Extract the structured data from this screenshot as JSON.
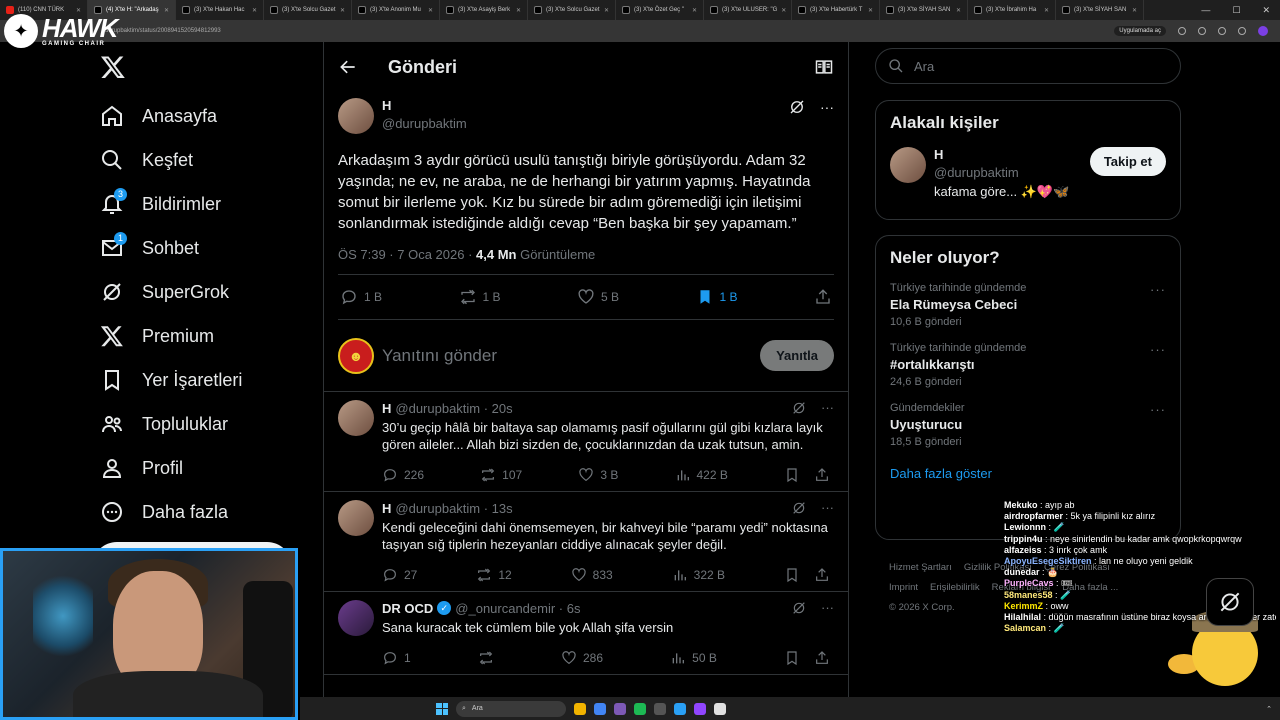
{
  "browser": {
    "tabs": [
      {
        "label": "(110) CNN TÜRK",
        "icon": "youtube-icon",
        "active": false
      },
      {
        "label": "(4) X'te H: \"Arkadaş",
        "icon": "x-icon",
        "active": true
      },
      {
        "label": "(3) X'te Hakan Hac",
        "icon": "x-icon",
        "active": false
      },
      {
        "label": "(3) X'te Solcu Gazet",
        "icon": "x-icon",
        "active": false
      },
      {
        "label": "(3) X'te Anonim Mu",
        "icon": "x-icon",
        "active": false
      },
      {
        "label": "(3) X'te Asayiş Berk",
        "icon": "x-icon",
        "active": false
      },
      {
        "label": "(3) X'te Solcu Gazet",
        "icon": "x-icon",
        "active": false
      },
      {
        "label": "(3) X'te Özet Geç \"",
        "icon": "x-icon",
        "active": false
      },
      {
        "label": "(3) X'te ULUSER: \"G",
        "icon": "x-icon",
        "active": false
      },
      {
        "label": "(3) X'te Habertürk T",
        "icon": "x-icon",
        "active": false
      },
      {
        "label": "(3) X'te SİYAH SAN",
        "icon": "x-icon",
        "active": false
      },
      {
        "label": "(3) X'te İbrahim Ha",
        "icon": "x-icon",
        "active": false
      },
      {
        "label": "(3) X'te SİYAH SAN",
        "icon": "x-icon",
        "active": false
      }
    ],
    "url": "durupbaktim/status/2008941520594812993",
    "open_in_app": "Uygulamada aç"
  },
  "overlay": {
    "brand": "HAWK",
    "brand_sub": "GAMING CHAIR"
  },
  "sidebar": {
    "items": [
      {
        "label": "Anasayfa",
        "icon": "home-icon"
      },
      {
        "label": "Keşfet",
        "icon": "search-icon"
      },
      {
        "label": "Bildirimler",
        "icon": "bell-icon",
        "badge": "3"
      },
      {
        "label": "Sohbet",
        "icon": "mail-icon",
        "badge": "1"
      },
      {
        "label": "SuperGrok",
        "icon": "grok-icon"
      },
      {
        "label": "Premium",
        "icon": "x-icon"
      },
      {
        "label": "Yer İşaretleri",
        "icon": "bookmark-icon"
      },
      {
        "label": "Topluluklar",
        "icon": "people-icon"
      },
      {
        "label": "Profil",
        "icon": "person-icon"
      },
      {
        "label": "Daha fazla",
        "icon": "more-circle-icon"
      }
    ]
  },
  "main": {
    "title": "Gönderi",
    "tweet": {
      "name": "H",
      "handle": "@durupbaktim",
      "text": "Arkadaşım 3 aydır görücü usulü tanıştığı biriyle görüşüyordu. Adam 32 yaşında; ne ev, ne araba, ne de herhangi bir yatırım yapmış. Hayatında somut bir ilerleme yok. Kız bu sürede bir adım göremediği için iletişimi sonlandırmak istediğinde aldığı cevap “Ben başka bir şey yapamam.”",
      "time": "ÖS 7:39 · 7 Oca 2026 · ",
      "views": "4,4 Mn",
      "views_label": " Görüntüleme",
      "replies": "1 B",
      "reposts": "1 B",
      "likes": "5 B",
      "bookmarks": "1 B"
    },
    "reply_box": {
      "placeholder": "Yanıtını gönder",
      "button": "Yanıtla"
    },
    "replies": [
      {
        "name": "H",
        "handle": "@durupbaktim · 20s",
        "verified": false,
        "text": "30’u geçip hâlâ bir baltaya sap olamamış pasif oğullarını gül gibi kızlara layık gören aileler... Allah bizi sizden de, çocuklarınızdan da uzak tutsun, amin.",
        "replies": "226",
        "reposts": "107",
        "likes": "3 B",
        "views": "422 B"
      },
      {
        "name": "H",
        "handle": "@durupbaktim · 13s",
        "verified": false,
        "text": "Kendi geleceğini dahi önemsemeyen, bir kahveyi bile “paramı yedi” noktasına taşıyan sığ tiplerin hezeyanları ciddiye alınacak şeyler değil.",
        "replies": "27",
        "reposts": "12",
        "likes": "833",
        "views": "322 B"
      },
      {
        "name": "DR OCD",
        "handle": "@_onurcandemir · 6s",
        "verified": true,
        "text": "Sana kuracak tek cümlem bile yok Allah şifa versin",
        "replies": "1",
        "reposts": "",
        "likes": "286",
        "views": "50 B"
      }
    ]
  },
  "right": {
    "search_placeholder": "Ara",
    "related": {
      "title": "Alakalı kişiler",
      "name": "H",
      "handle": "@durupbaktim",
      "bio": "kafama göre... ✨💖🦋",
      "follow": "Takip et"
    },
    "trends": {
      "title": "Neler oluyor?",
      "items": [
        {
          "context": "Türkiye tarihinde gündemde",
          "topic": "Ela Rümeysa Cebeci",
          "count": "10,6 B gönderi"
        },
        {
          "context": "Türkiye tarihinde gündemde",
          "topic": "#ortalıkkarıştı",
          "count": "24,6 B gönderi"
        },
        {
          "context": "Gündemdekiler",
          "topic": "Uyuşturucu",
          "count": "18,5 B gönderi"
        }
      ],
      "show_more": "Daha fazla göster"
    },
    "footer": [
      "Hizmet Şartları",
      "Gizlilik Politikası",
      "Çerez Politikası",
      "Imprint",
      "Erişilebilirlik",
      "Reklam bilgisi",
      "Daha fazla ...",
      "© 2026 X Corp."
    ]
  },
  "chat": [
    {
      "user": "Mekuko",
      "msg": "ayıp ab",
      "color": "w"
    },
    {
      "user": "airdropfarmer",
      "msg": "5k ya filipinli kız alırız",
      "color": "w"
    },
    {
      "user": "Lewionnn",
      "msg": "🧪",
      "color": "w"
    },
    {
      "user": "trippin4u",
      "msg": "neye sinirlendin bu kadar amk qwopkrkopqwrqw",
      "color": "w"
    },
    {
      "user": "alfazeiss",
      "msg": "3 inrk çok amk",
      "color": "w"
    },
    {
      "user": "ApoyuEsegeSiktiren",
      "msg": "lan ne oluyo yeni geldik",
      "color": "b"
    },
    {
      "user": "dunedar",
      "msg": "🎂",
      "color": "w"
    },
    {
      "user": "PurpleCavs",
      "msg": "🎟",
      "color": "p"
    },
    {
      "user": "58manes58",
      "msg": "🧪",
      "color": "g"
    },
    {
      "user": "KerimmZ",
      "msg": "oww",
      "color": "y"
    },
    {
      "user": "Hilalhilal",
      "msg": "düğün masrafının üstüne biraz koysa araba alabilirler zaten illa araba diyorsan düğün yapma abla",
      "color": "w"
    },
    {
      "user": "Salamcan",
      "msg": "🧪",
      "color": "g"
    }
  ],
  "taskbar": {
    "search": "Ara"
  }
}
